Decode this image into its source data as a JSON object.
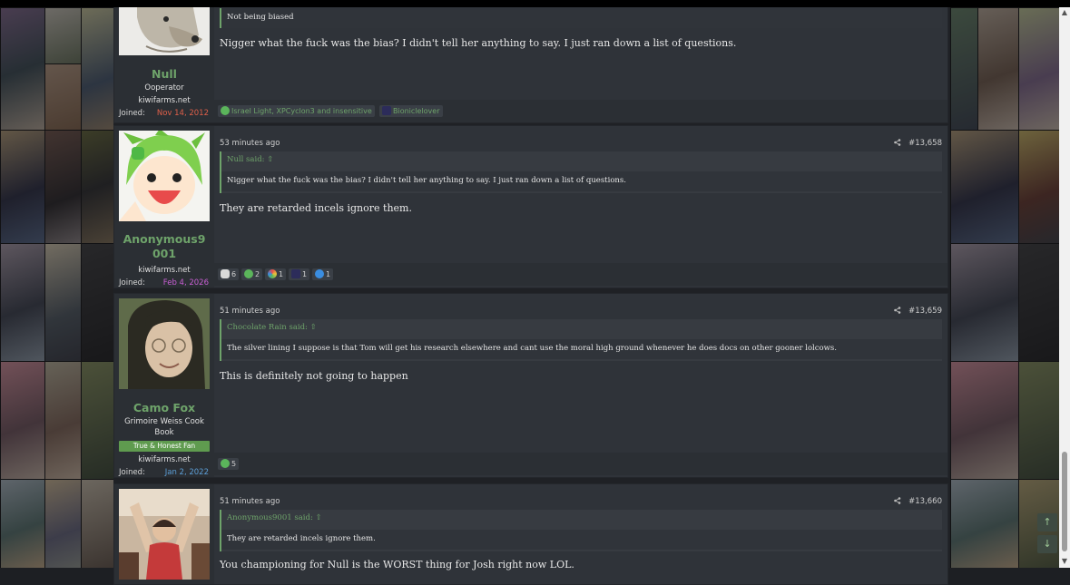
{
  "posts": [
    {
      "username": "Null",
      "user_title": "Ooperator",
      "site": "kiwifarms.net",
      "joined_label": "Joined:",
      "joined_date": "Nov 14, 2012",
      "joined_color": "#e0604a",
      "quote_body": "Not being biased",
      "message": "Nigger what the fuck was the bias? I didn't tell her anything to say. I just ran down a list of questions.",
      "reaction_text_1": "Israel Light, XPCyclon3 and insensitive",
      "reaction_text_2": "Bioniclelover"
    },
    {
      "time": "53 minutes ago",
      "post_number": "#13,658",
      "username": "Anonymous9001",
      "site": "kiwifarms.net",
      "joined_label": "Joined:",
      "joined_date": "Feb 4, 2026",
      "joined_color": "#c95fd4",
      "quote_author": "Null said:",
      "quote_body": "Nigger what the fuck was the bias? I didn't tell her anything to say. I just ran down a list of questions.",
      "message": "They are retarded incels ignore them.",
      "reactions": [
        {
          "icon": "hand-icon",
          "count": "6",
          "color": "#d9d9d9"
        },
        {
          "icon": "check-icon",
          "count": "2",
          "color": "#5bb55b"
        },
        {
          "icon": "rainbow-icon",
          "count": "1",
          "color": "#e8c53c"
        },
        {
          "icon": "hat-icon",
          "count": "1",
          "color": "#2c2c5a"
        },
        {
          "icon": "cloud-icon",
          "count": "1",
          "color": "#3a8de0"
        }
      ]
    },
    {
      "time": "51 minutes ago",
      "post_number": "#13,659",
      "username": "Camo Fox",
      "user_title": "Grimoire Weiss Cook Book",
      "badge": "True & Honest Fan",
      "site": "kiwifarms.net",
      "joined_label": "Joined:",
      "joined_date": "Jan 2, 2022",
      "joined_color": "#5c9fd8",
      "quote_author": "Chocolate Rain said:",
      "quote_body": "The silver lining I suppose is that Tom will get his research elsewhere and cant use the moral high ground whenever he does docs on other gooner lolcows.",
      "message": "This is definitely not going to happen",
      "reactions": [
        {
          "icon": "check-icon",
          "count": "5",
          "color": "#5bb55b"
        }
      ]
    },
    {
      "time": "51 minutes ago",
      "post_number": "#13,660",
      "quote_author": "Anonymous9001 said:",
      "quote_body": "They are retarded incels ignore them.",
      "message": "You championing for Null is the WORST thing for Josh right now LOL."
    }
  ],
  "nav": {
    "up": "↑",
    "down": "↓"
  },
  "scroll": {
    "up": "▲",
    "down": "▼"
  }
}
